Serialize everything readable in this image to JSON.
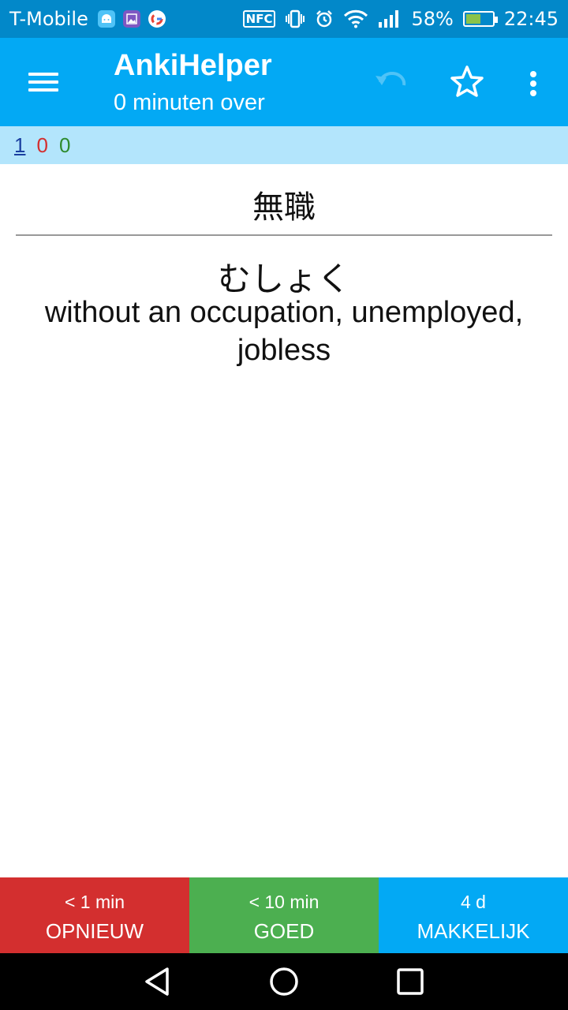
{
  "status_bar": {
    "carrier": "T-Mobile",
    "battery_percent": "58%",
    "battery_level": 0.58,
    "time": "22:45",
    "nfc_label": "NFC",
    "icons_left": [
      "android-icon",
      "gallery-icon",
      "google-icon"
    ],
    "icons_right": [
      "nfc-icon",
      "vibrate-icon",
      "alarm-icon",
      "wifi-icon",
      "signal-icon",
      "battery-charging-icon"
    ]
  },
  "app_bar": {
    "title": "AnkiHelper",
    "subtitle": "0 minuten over",
    "icons": [
      "menu-icon",
      "undo-icon",
      "star-icon",
      "more-vert-icon"
    ]
  },
  "counts": {
    "new": "1",
    "learning": "0",
    "review": "0"
  },
  "card": {
    "front": "無職",
    "reading": "むしょく",
    "meaning": "without an occupation, unemployed, jobless"
  },
  "answer_buttons": [
    {
      "interval": "< 1 min",
      "label": "OPNIEUW",
      "color": "#d32f2f"
    },
    {
      "interval": "< 10 min",
      "label": "GOED",
      "color": "#4caf50"
    },
    {
      "interval": "4 d",
      "label": "MAKKELIJK",
      "color": "#03a9f4"
    }
  ],
  "colors": {
    "status_bar": "#0288c9",
    "app_bar": "#03a9f4",
    "count_bar": "#b3e5fc"
  }
}
